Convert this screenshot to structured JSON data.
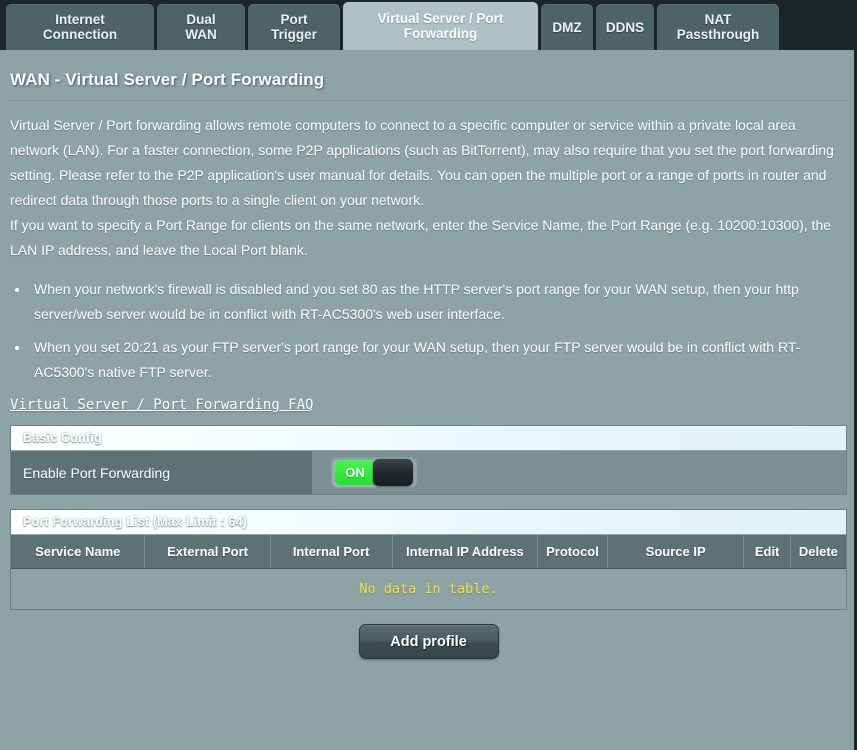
{
  "tabs": [
    {
      "label": "Internet\nConnection",
      "active": false,
      "name": "tab-internet-connection"
    },
    {
      "label": "Dual\nWAN",
      "active": false,
      "name": "tab-dual-wan"
    },
    {
      "label": "Port\nTrigger",
      "active": false,
      "name": "tab-port-trigger"
    },
    {
      "label": "Virtual Server / Port\nForwarding",
      "active": true,
      "name": "tab-virtual-server-port-forwarding"
    },
    {
      "label": "DMZ",
      "active": false,
      "name": "tab-dmz"
    },
    {
      "label": "DDNS",
      "active": false,
      "name": "tab-ddns"
    },
    {
      "label": "NAT\nPassthrough",
      "active": false,
      "name": "tab-nat-passthrough"
    }
  ],
  "page": {
    "title": "WAN - Virtual Server / Port Forwarding",
    "description": [
      "Virtual Server / Port forwarding allows remote computers to connect to a specific computer or service within a private local area network (LAN). For a faster connection, some P2P applications (such as BitTorrent), may also require that you set the port forwarding setting. Please refer to the P2P application's user manual for details. You can open the multiple port or a range of ports in router and redirect data through those ports to a single client on your network.",
      "If you want to specify a Port Range for clients on the same network, enter the Service Name, the Port Range (e.g. 10200:10300), the LAN IP address, and leave the Local Port blank."
    ],
    "notes": [
      "When your network's firewall is disabled and you set 80 as the HTTP server's port range for your WAN setup, then your http server/web server would be in conflict with RT-AC5300's web user interface.",
      "When you set 20:21 as your FTP server's port range for your WAN setup, then your FTP server would be in conflict with RT-AC5300's native FTP server."
    ],
    "faq_link": "Virtual Server / Port Forwarding FAQ"
  },
  "basic_config": {
    "header": "Basic Config",
    "enable_label": "Enable Port Forwarding",
    "toggle_state": "ON"
  },
  "port_forwarding_list": {
    "header": "Port Forwarding List (Max Limit : 64)",
    "columns": [
      "Service Name",
      "External Port",
      "Internal Port",
      "Internal IP Address",
      "Protocol",
      "Source IP",
      "Edit",
      "Delete"
    ],
    "empty_message": "No data in table.",
    "rows": []
  },
  "actions": {
    "add_profile": "Add profile"
  },
  "colors": {
    "page_background": "#8da3a6",
    "tabbar_background": "#1c2527",
    "tab_inactive": "#4d6366",
    "tab_active": "#aec2c5",
    "toggle_on_green": "#2ee33a",
    "empty_text_yellow": "#f2e23a",
    "panel_background": "#5e7376"
  }
}
